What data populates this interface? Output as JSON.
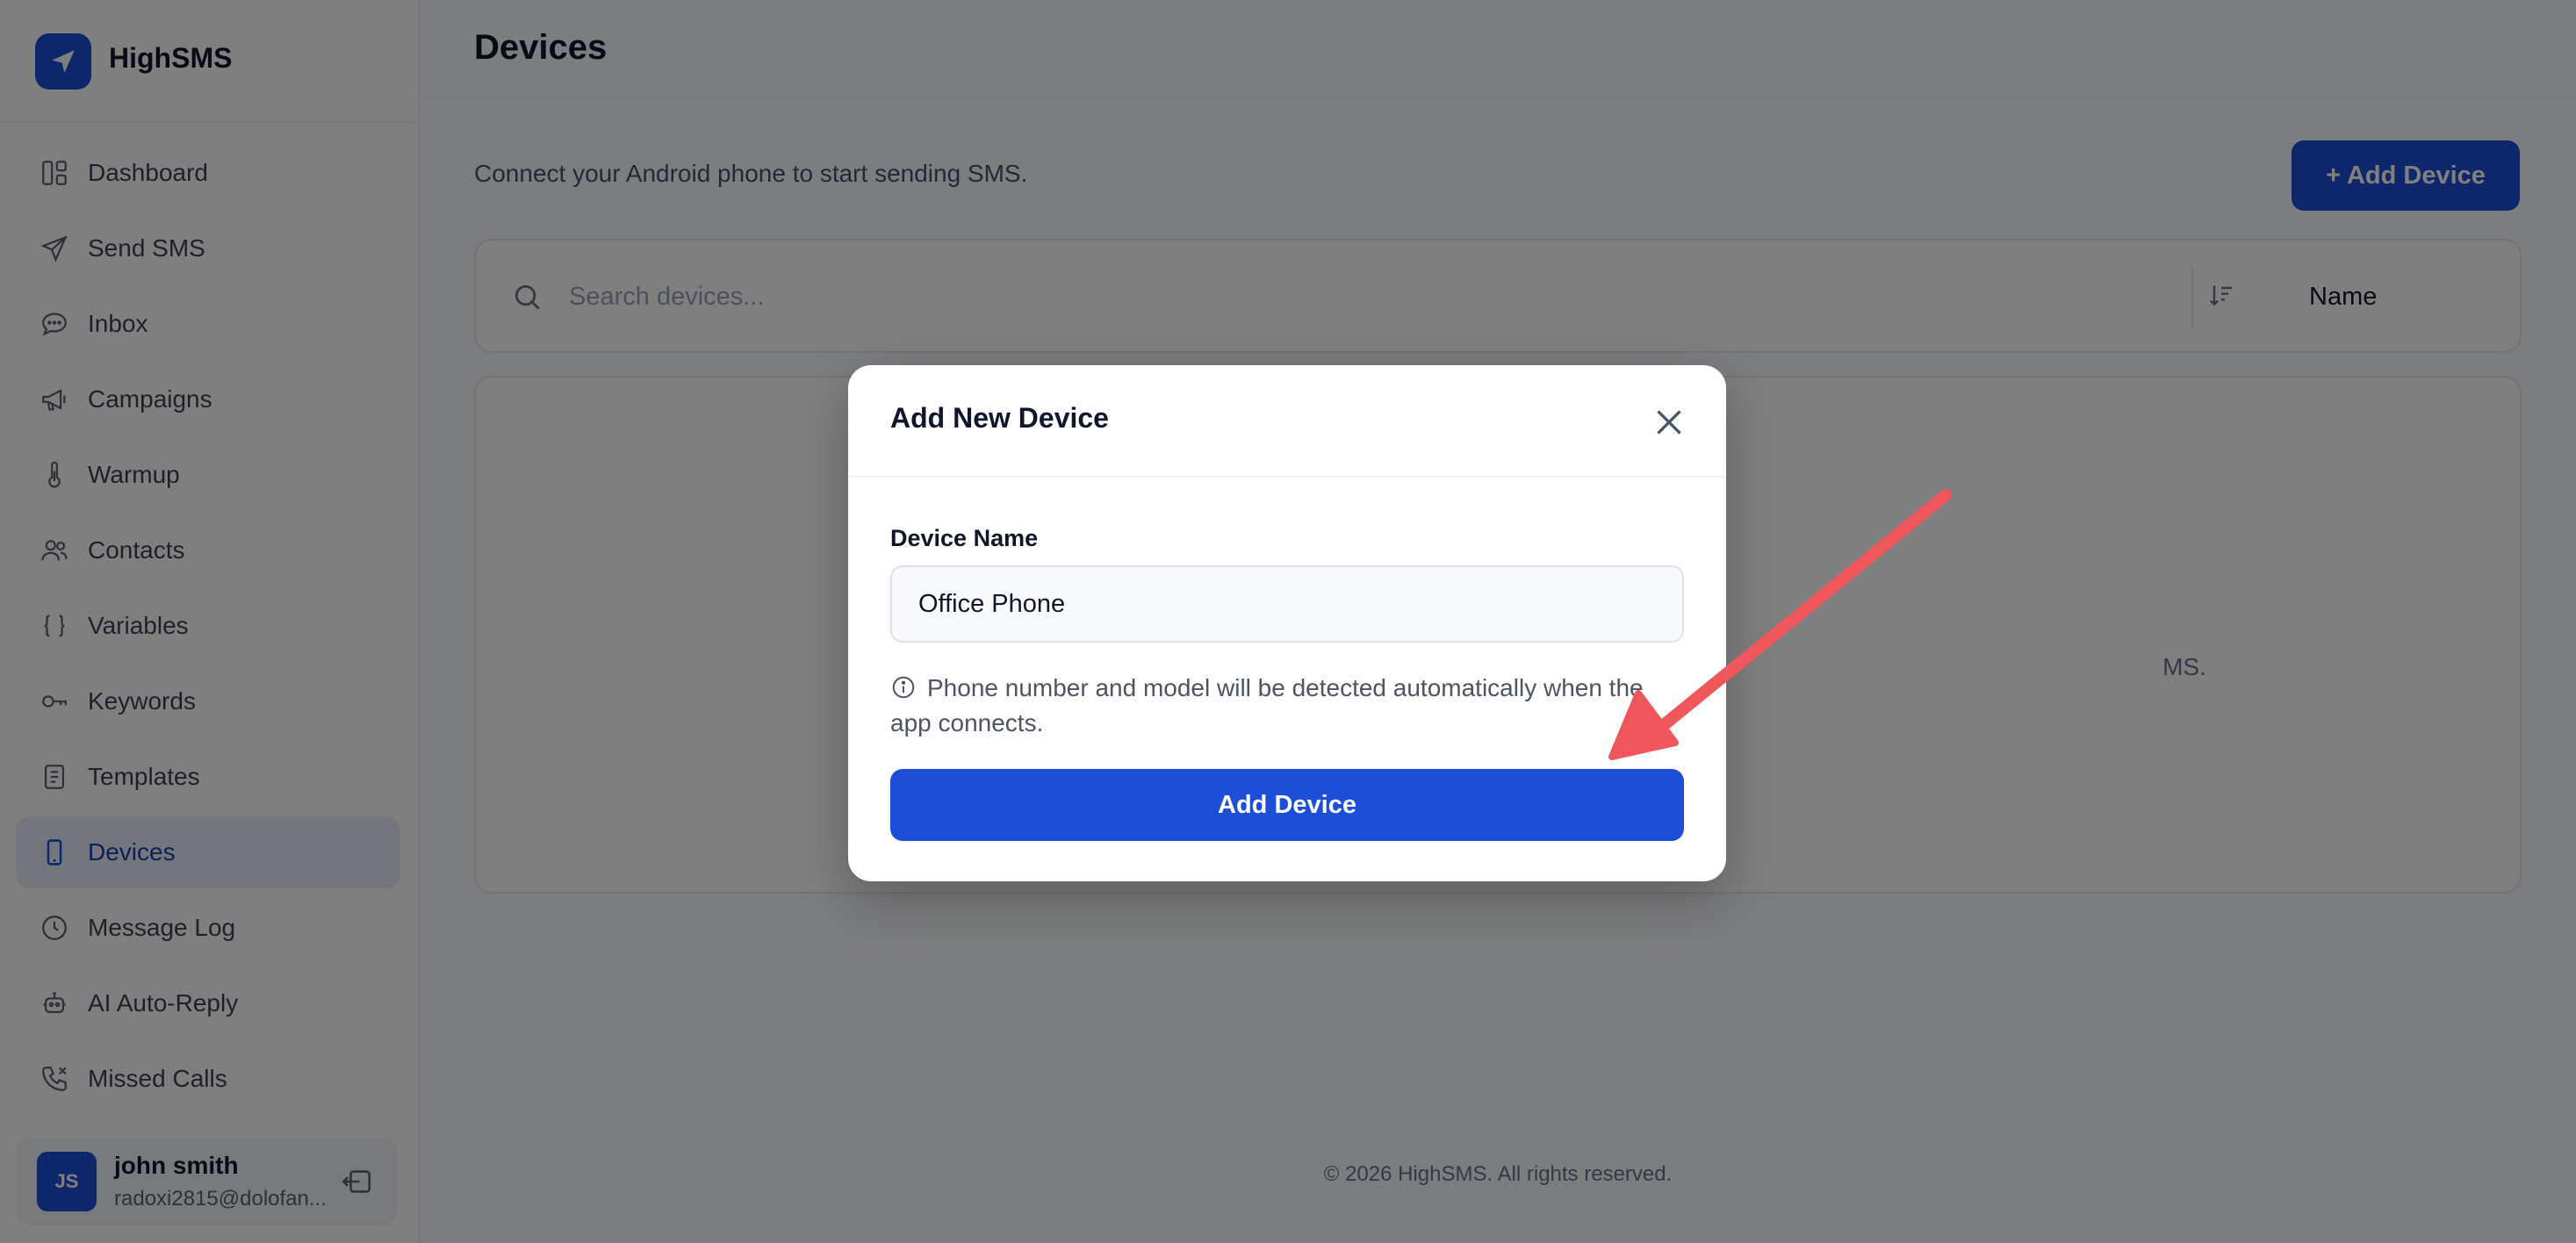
{
  "app": {
    "name": "HighSMS"
  },
  "sidebar": {
    "items": [
      {
        "label": "Dashboard",
        "icon": "dashboard-icon"
      },
      {
        "label": "Send SMS",
        "icon": "send-icon"
      },
      {
        "label": "Inbox",
        "icon": "chat-bubble-icon"
      },
      {
        "label": "Campaigns",
        "icon": "megaphone-icon"
      },
      {
        "label": "Warmup",
        "icon": "thermometer-icon"
      },
      {
        "label": "Contacts",
        "icon": "users-icon"
      },
      {
        "label": "Variables",
        "icon": "braces-icon"
      },
      {
        "label": "Keywords",
        "icon": "key-icon"
      },
      {
        "label": "Templates",
        "icon": "document-icon"
      },
      {
        "label": "Devices",
        "icon": "phone-icon",
        "active": true
      },
      {
        "label": "Message Log",
        "icon": "clock-icon"
      },
      {
        "label": "AI Auto-Reply",
        "icon": "robot-icon"
      },
      {
        "label": "Missed Calls",
        "icon": "phone-missed-icon"
      }
    ],
    "user": {
      "initials": "JS",
      "name": "john smith",
      "email": "radoxi2815@dolofan..."
    }
  },
  "main": {
    "title": "Devices",
    "subtitle": "Connect your Android phone to start sending SMS.",
    "add_button": "+ Add Device",
    "search": {
      "placeholder": "Search devices...",
      "sort_label": "Name"
    },
    "empty_text_tail": "MS.",
    "footer": "© 2026 HighSMS. All rights reserved."
  },
  "modal": {
    "title": "Add New Device",
    "field_label": "Device Name",
    "field_value": "Office Phone",
    "hint": "Phone number and model will be detected automatically when the app connects.",
    "button": "Add Device"
  },
  "colors": {
    "accent": "#1d4ed8",
    "annotation": "#f0575d",
    "overlay": "rgba(0,0,0,0.5)"
  }
}
